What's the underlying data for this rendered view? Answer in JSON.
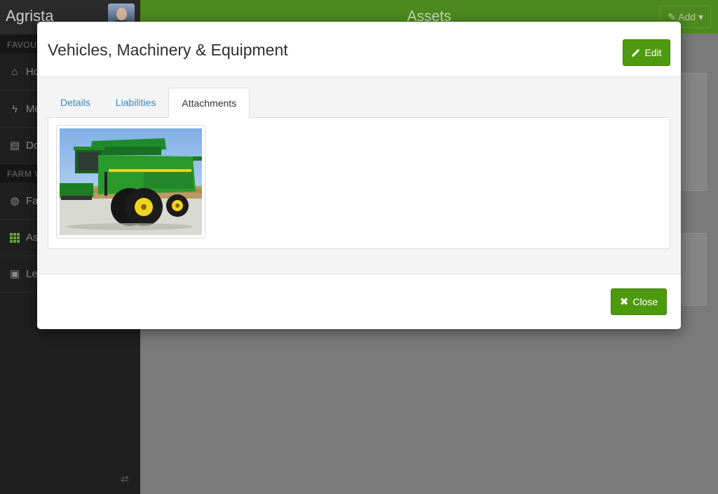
{
  "app": {
    "brand": "Agrista",
    "page_title": "Assets",
    "add_label": "Add"
  },
  "sidebar": {
    "headings": [
      "FAVOUR",
      "FARM V"
    ],
    "items": [
      {
        "label": "Ho",
        "icon": "home-icon"
      },
      {
        "label": "Me",
        "icon": "bolt-icon"
      },
      {
        "label": "Do",
        "icon": "documents-icon"
      },
      {
        "label": "Fa",
        "icon": "globe-icon"
      },
      {
        "label": "As",
        "icon": "grid-icon"
      },
      {
        "label": "Le",
        "icon": "contact-icon"
      }
    ]
  },
  "modal": {
    "title": "Vehicles, Machinery & Equipment",
    "edit_label": "Edit",
    "tabs": [
      "Details",
      "Liabilities",
      "Attachments"
    ],
    "active_tab": "Attachments",
    "attachments": [
      {
        "type": "image",
        "depicts": "green combine harvester"
      }
    ],
    "close_label": "Close"
  },
  "colors": {
    "accent_green": "#4e9a0e",
    "link_blue": "#3a87c7",
    "sidebar_bg": "#1f1f1f",
    "topbar_green": "#4c8a1d"
  }
}
